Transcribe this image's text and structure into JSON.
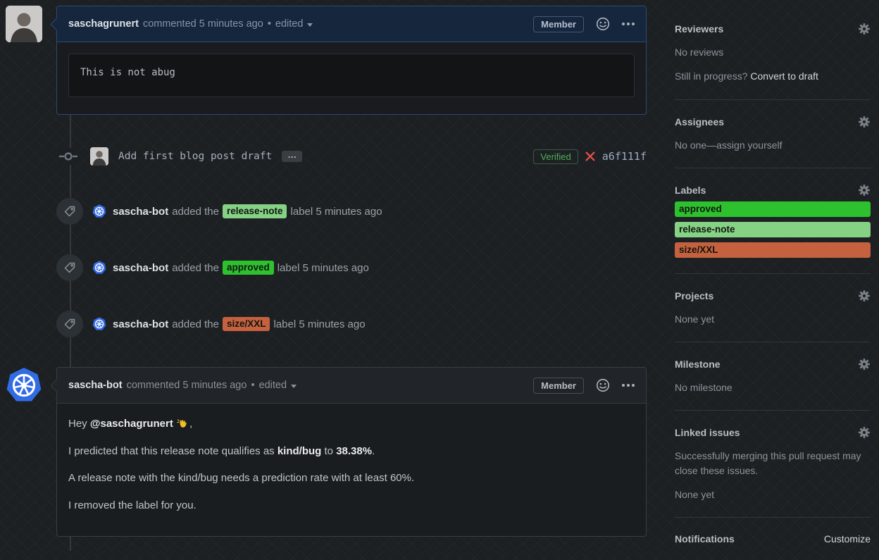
{
  "comments": [
    {
      "author": "saschagrunert",
      "meta": "commented 5 minutes ago",
      "dot": "•",
      "edited_label": "edited",
      "member_badge": "Member",
      "code": "This is not abug"
    },
    {
      "author": "sascha-bot",
      "meta": "commented 5 minutes ago",
      "dot": "•",
      "edited_label": "edited",
      "member_badge": "Member",
      "p1_pre": "Hey ",
      "p1_mention": "@saschagrunert",
      "p1_end": ",",
      "p2_pre": "I predicted that this release note qualifies as ",
      "p2_bold1": "kind/bug",
      "p2_mid": " to ",
      "p2_bold2": "38.38%",
      "p2_end": ".",
      "p3": "A release note with the kind/bug needs a prediction rate with at least 60%.",
      "p4": "I removed the label for you."
    }
  ],
  "commit": {
    "message": "Add first blog post draft",
    "verified_label": "Verified",
    "hash": "a6f111f"
  },
  "events": [
    {
      "actor": "sascha-bot",
      "action": "added the",
      "label": "release-note",
      "label_color": "#85d285",
      "suffix": "label 5 minutes ago"
    },
    {
      "actor": "sascha-bot",
      "action": "added the",
      "label": "approved",
      "label_color": "#2dc22d",
      "suffix": "label 5 minutes ago"
    },
    {
      "actor": "sascha-bot",
      "action": "added the",
      "label": "size/XXL",
      "label_color": "#c5613e",
      "suffix": "label 5 minutes ago"
    }
  ],
  "sidebar": {
    "reviewers": {
      "title": "Reviewers",
      "empty": "No reviews",
      "hint": "Still in progress? ",
      "link": "Convert to draft"
    },
    "assignees": {
      "title": "Assignees",
      "empty": "No one—assign yourself"
    },
    "labels": {
      "title": "Labels",
      "items": [
        {
          "name": "approved",
          "color": "#2dc22d"
        },
        {
          "name": "release-note",
          "color": "#85d285"
        },
        {
          "name": "size/XXL",
          "color": "#c5613e"
        }
      ]
    },
    "projects": {
      "title": "Projects",
      "empty": "None yet"
    },
    "milestone": {
      "title": "Milestone",
      "empty": "No milestone"
    },
    "linked_issues": {
      "title": "Linked issues",
      "desc": "Successfully merging this pull request may close these issues.",
      "empty": "None yet"
    },
    "notifications": {
      "title": "Notifications",
      "link": "Customize"
    }
  },
  "colors": {
    "k8s_blue": "#326ce5",
    "verified_green": "#4db158",
    "x_red": "#e25048"
  }
}
